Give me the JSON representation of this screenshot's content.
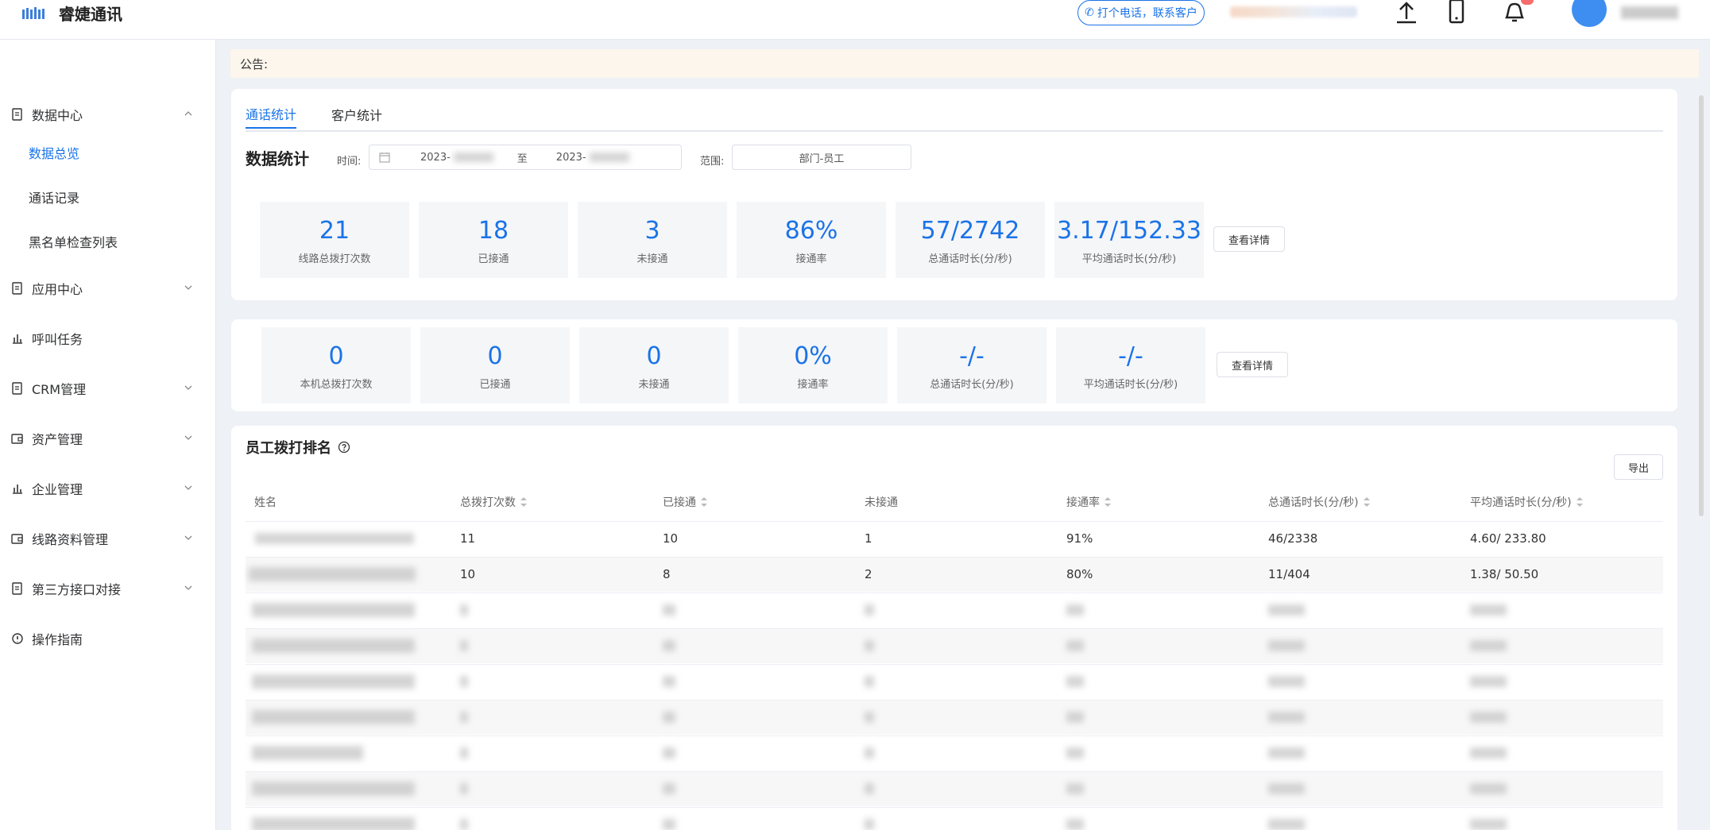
{
  "header": {
    "brand": "睿婕通讯",
    "call_label": "打个电话，联系客户"
  },
  "sidebar": {
    "items": [
      {
        "label": "数据中心",
        "expanded": true
      },
      {
        "label": "应用中心"
      },
      {
        "label": "呼叫任务"
      },
      {
        "label": "CRM管理"
      },
      {
        "label": "资产管理"
      },
      {
        "label": "企业管理"
      },
      {
        "label": "线路资料管理"
      },
      {
        "label": "第三方接口对接"
      },
      {
        "label": "操作指南"
      }
    ],
    "sub_items": [
      "数据总览",
      "通话记录",
      "黑名单检查列表"
    ],
    "active_sub": "数据总览"
  },
  "notice": "公告:",
  "stats": {
    "tabs": [
      "通话统计",
      "客户统计"
    ],
    "active_tab": "通话统计",
    "title": "数据统计",
    "time_label": "时间:",
    "start_date": "2023-",
    "to": "至",
    "end_date": "2023-",
    "range_label": "范围:",
    "range_value": "部门-员工",
    "line_cards": [
      {
        "value": "21",
        "label": "线路总拨打次数"
      },
      {
        "value": "18",
        "label": "已接通"
      },
      {
        "value": "3",
        "label": "未接通"
      },
      {
        "value": "86%",
        "label": "接通率"
      },
      {
        "value": "57/2742",
        "label": "总通话时长(分/秒)"
      },
      {
        "value": "3.17/152.33",
        "label": "平均通话时长(分/秒)"
      }
    ],
    "local_cards": [
      {
        "value": "0",
        "label": "本机总拨打次数"
      },
      {
        "value": "0",
        "label": "已接通"
      },
      {
        "value": "0",
        "label": "未接通"
      },
      {
        "value": "0%",
        "label": "接通率"
      },
      {
        "value": "-/-",
        "label": "总通话时长(分/秒)"
      },
      {
        "value": "-/-",
        "label": "平均通话时长(分/秒)"
      }
    ],
    "detail_button": "查看详情"
  },
  "ranking": {
    "title": "员工拨打排名",
    "export": "导出",
    "columns": [
      "姓名",
      "总拨打次数",
      "已接通",
      "未接通",
      "接通率",
      "总通话时长(分/秒)",
      "平均通话时长(分/秒)"
    ],
    "rows": [
      [
        "",
        "11",
        "10",
        "1",
        "91%",
        "46/2338",
        "4.60/ 233.80"
      ],
      [
        "",
        "10",
        "8",
        "2",
        "80%",
        "11/404",
        "1.38/ 50.50"
      ]
    ]
  },
  "colors": {
    "accent": "#1a73e8",
    "notice_bg": "#fdf6ec"
  }
}
